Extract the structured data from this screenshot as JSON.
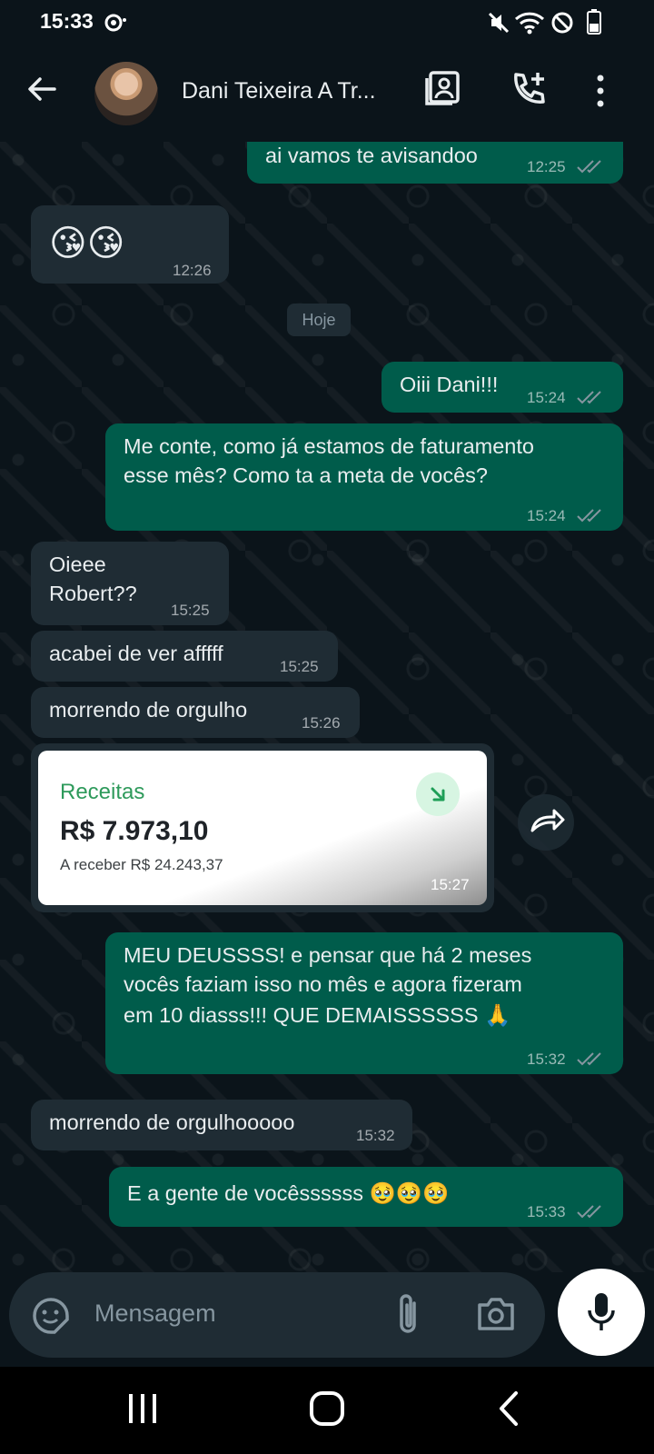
{
  "status_bar": {
    "time": "15:33"
  },
  "header": {
    "contact_name": "Dani Teixeira A Tr..."
  },
  "date_chip": "Hoje",
  "messages": [
    {
      "text": "ai vamos te avisandoo",
      "time": "12:25"
    },
    {
      "text": "😘😘",
      "time": "12:26"
    },
    {
      "text": "Oiii Dani!!!",
      "time": "15:24"
    },
    {
      "line1": "Me conte, como já estamos de faturamento",
      "line2": "esse mês? Como ta a meta de vocês?",
      "time": "15:24"
    },
    {
      "line1": "Oieee",
      "line2": "Robert??",
      "time": "15:25"
    },
    {
      "text": "acabei de ver afffff",
      "time": "15:25"
    },
    {
      "text": "morrendo de orgulho",
      "time": "15:26"
    },
    {
      "line1": "MEU DEUSSSS! e pensar que há 2 meses",
      "line2": "vocês faziam isso no mês e agora fizeram",
      "line3": "em 10 diasss!!! QUE DEMAISSSSSS 🙏",
      "time": "15:32"
    },
    {
      "text": "morrendo de orgulhooooo",
      "time": "15:32"
    },
    {
      "text": "E a gente de vocêssssss 🥹🥹🥹",
      "time": "15:33"
    }
  ],
  "image_card": {
    "label": "Receitas",
    "value": "R$ 7.973,10",
    "subtitle": "A receber R$ 24.243,37",
    "time": "15:27"
  },
  "composer": {
    "placeholder": "Mensagem"
  },
  "colors": {
    "background": "#0b141a",
    "incoming_bubble": "#1f2c34",
    "outgoing_bubble": "#005c4b",
    "accent_green": "#2e9a5b"
  },
  "icons": [
    "sync-icon",
    "mute-icon",
    "wifi-icon",
    "do-not-disturb-icon",
    "battery-icon",
    "back-arrow-icon",
    "contact-card-icon",
    "add-call-icon",
    "more-vert-icon",
    "double-check-icon",
    "forward-icon",
    "sticker-icon",
    "attach-icon",
    "camera-icon",
    "mic-icon",
    "recents-icon",
    "home-icon",
    "back-icon"
  ]
}
